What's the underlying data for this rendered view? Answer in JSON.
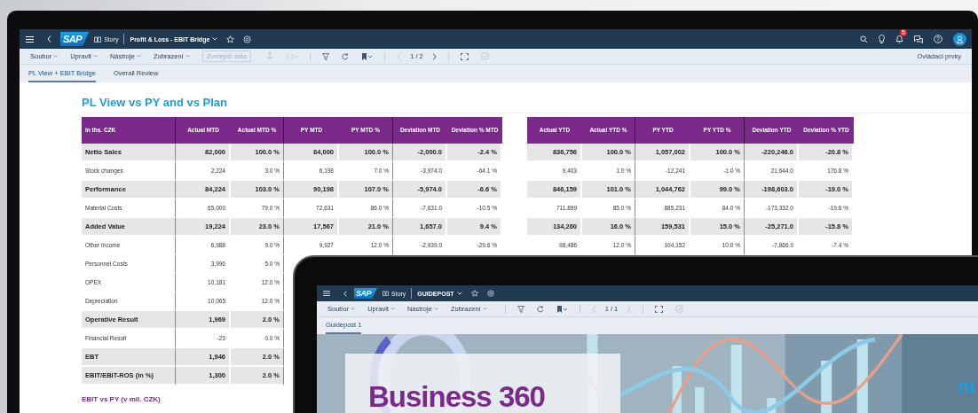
{
  "shell": {
    "logo": "SAP",
    "type_label": "Story",
    "title": "Profit & Loss - EBIT Bridge",
    "notification_count": "5"
  },
  "menus": [
    {
      "label": "Soubor"
    },
    {
      "label": "Upravit"
    },
    {
      "label": "Nástroje"
    },
    {
      "label": "Zobrazení"
    }
  ],
  "publish_button": {
    "label": "Zveřejnit data",
    "disabled": true
  },
  "pager": "1 / 2",
  "controls_link": "Ovládací prvky",
  "tabs": [
    {
      "label": "PL View + EBIT Bridge",
      "selected": true
    },
    {
      "label": "Overall Review",
      "selected": false
    }
  ],
  "report": {
    "title": "PL View vs PY and vs Plan",
    "mtd_table": {
      "columns": [
        "in ths. CZK",
        "Actual MTD",
        "Actual MTD %",
        "PY MTD",
        "PY MTD %",
        "Deviation MTD",
        "Deviation % MTD"
      ],
      "rows": [
        {
          "label": "Netto Sales",
          "bold": true,
          "values": [
            "82,000",
            "100.0 %",
            "84,000",
            "100.0 %",
            "-2,000.0",
            "-2.4 %"
          ]
        },
        {
          "label": "Stock changes",
          "bold": false,
          "values": [
            "2,224",
            "3.0 %",
            "6,198",
            "7.0 %",
            "-3,974.0",
            "-64.1 %"
          ]
        },
        {
          "label": "Performance",
          "bold": true,
          "values": [
            "84,224",
            "103.0 %",
            "90,198",
            "107.0 %",
            "-5,974.0",
            "-6.6 %"
          ]
        },
        {
          "label": "Material Costs",
          "bold": false,
          "values": [
            "65,000",
            "79.0 %",
            "72,631",
            "86.0 %",
            "-7,631.0",
            "-10.5 %"
          ]
        },
        {
          "label": "Added Value",
          "bold": true,
          "values": [
            "19,224",
            "23.0 %",
            "17,567",
            "21.0 %",
            "1,657.0",
            "9.4 %"
          ]
        },
        {
          "label": "Other Income",
          "bold": false,
          "values": [
            "6,988",
            "9.0 %",
            "9,927",
            "12.0 %",
            "-2,939.0",
            "-29.6 %"
          ]
        },
        {
          "label": "Personnel Costs",
          "bold": false,
          "values": [
            "3,996",
            "5.0 %"
          ]
        },
        {
          "label": "OPEX",
          "bold": false,
          "values": [
            "10,181",
            "12.0 %"
          ]
        },
        {
          "label": "Depreciation",
          "bold": false,
          "values": [
            "10,065",
            "12.0 %"
          ]
        },
        {
          "label": "Operative Result",
          "bold": true,
          "values": [
            "1,969",
            "2.0 %"
          ]
        },
        {
          "label": "Financial Result",
          "bold": false,
          "values": [
            "-23",
            "0.0 %"
          ]
        },
        {
          "label": "EBT",
          "bold": true,
          "values": [
            "1,946",
            "2.0 %"
          ]
        },
        {
          "label": "EBIT/EBIT-ROS (in %)",
          "bold": true,
          "values": [
            "1,300",
            "2.0 %"
          ]
        }
      ]
    },
    "ytd_table": {
      "columns": [
        "Actual YTD",
        "Actual YTD %",
        "PY YTD",
        "PY YTD %",
        "Deviation YTD",
        "Deviation % YTD"
      ],
      "rows": [
        {
          "bold": true,
          "values": [
            "836,756",
            "100.0 %",
            "1,057,002",
            "100.0 %",
            "-220,246.0",
            "-20.8 %"
          ]
        },
        {
          "bold": false,
          "values": [
            "9,403",
            "1.0 %",
            "-12,241",
            "-1.0 %",
            "21,644.0",
            "176.8 %"
          ]
        },
        {
          "bold": true,
          "values": [
            "846,159",
            "101.0 %",
            "1,044,762",
            "99.0 %",
            "-198,603.0",
            "-19.0 %"
          ]
        },
        {
          "bold": false,
          "values": [
            "711,899",
            "85.0 %",
            "885,231",
            "84.0 %",
            "-173,332.0",
            "-19.6 %"
          ]
        },
        {
          "bold": true,
          "values": [
            "134,260",
            "16.0 %",
            "159,531",
            "15.0 %",
            "-25,271.0",
            "-15.8 %"
          ]
        },
        {
          "bold": false,
          "values": [
            "98,486",
            "12.0 %",
            "104,152",
            "10.0 %",
            "-7,866.0",
            "-7.4 %"
          ]
        }
      ]
    },
    "chart_title": "EBIT vs PY (v mil. CZK)"
  },
  "tablet": {
    "shell": {
      "logo": "SAP",
      "type_label": "Story",
      "title": "GUIDEPOST"
    },
    "menus": [
      {
        "label": "Soubor"
      },
      {
        "label": "Upravit"
      },
      {
        "label": "Nástroje"
      },
      {
        "label": "Zobrazení"
      }
    ],
    "pager": "1 / 1",
    "tabs": [
      {
        "label": "Guidepost 1",
        "selected": true
      }
    ],
    "banner": {
      "kind": "picture",
      "title": "Business 360",
      "side_text": "m"
    }
  }
}
